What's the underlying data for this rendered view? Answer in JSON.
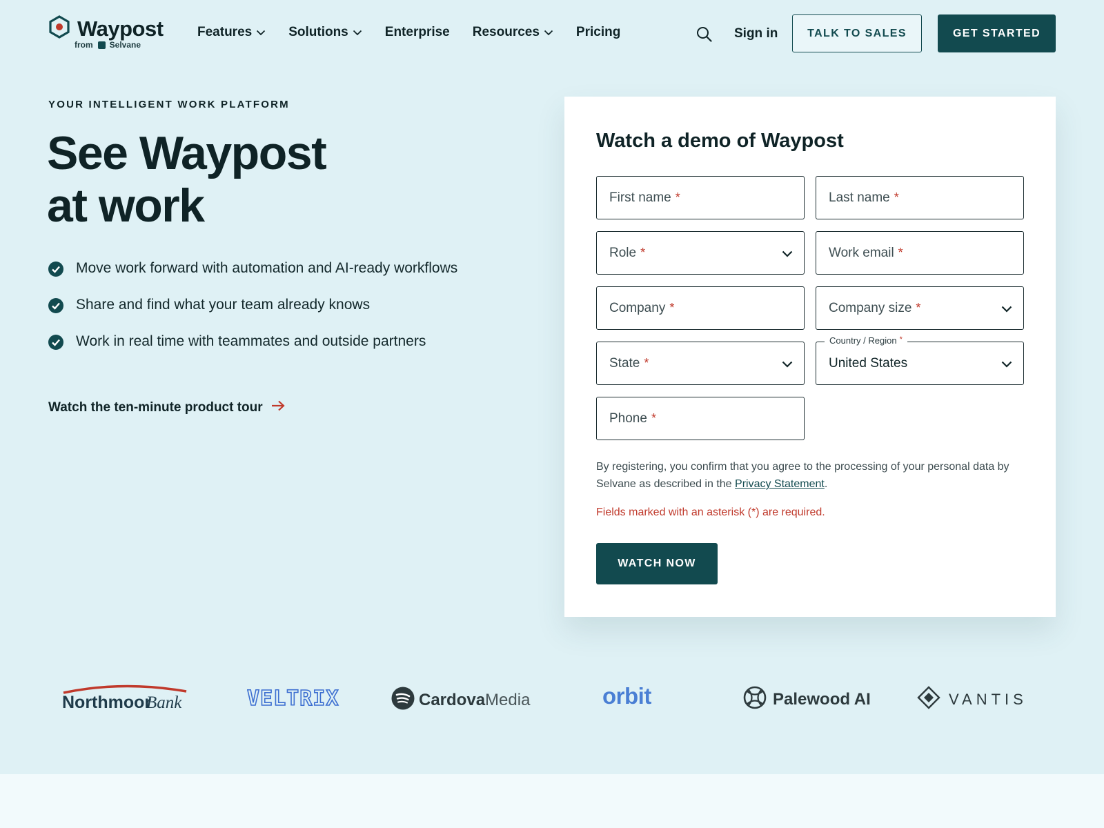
{
  "brand": {
    "name": "Waypost",
    "from_label": "from",
    "parent": "Selvane"
  },
  "nav": {
    "items": [
      {
        "label": "Features",
        "dropdown": true
      },
      {
        "label": "Solutions",
        "dropdown": true
      },
      {
        "label": "Enterprise",
        "dropdown": false
      },
      {
        "label": "Resources",
        "dropdown": true
      },
      {
        "label": "Pricing",
        "dropdown": false
      }
    ],
    "sign_in": "Sign in",
    "talk_to_sales": "TALK TO SALES",
    "get_started": "GET STARTED"
  },
  "hero": {
    "eyebrow": "YOUR INTELLIGENT WORK PLATFORM",
    "headline_line1": "See Waypost",
    "headline_line2": "at work",
    "bullets": [
      "Move work forward with automation and AI-ready workflows",
      "Share and find what your team already knows",
      "Work in real time with teammates and outside partners"
    ],
    "tour_link": "Watch the ten-minute product tour"
  },
  "form": {
    "title": "Watch a demo of Waypost",
    "required_mark": "*",
    "fields": {
      "first_name": "First name",
      "last_name": "Last name",
      "role": "Role",
      "work_email": "Work email",
      "company": "Company",
      "company_size": "Company size",
      "state": "State",
      "country_label": "Country / Region",
      "country_value": "United States",
      "phone": "Phone"
    },
    "consent_text": "By registering, you confirm that you agree to the processing of your personal data by Selvane as described in the ",
    "privacy_link": "Privacy Statement",
    "consent_end": ".",
    "required_note": "Fields marked with an asterisk (*) are required.",
    "submit": "WATCH NOW"
  },
  "customers": {
    "northmoor_a": "Northmoor",
    "northmoor_b": "Bank",
    "veltrix": "VELTRIX",
    "cardova_a": "Cardova",
    "cardova_b": "Media",
    "orbit": "orbit",
    "palewood": "Palewood AI",
    "vantis": "VANTIS"
  },
  "colors": {
    "background": "#dff1f5",
    "primary": "#124a4f",
    "accent_red": "#c0392b",
    "card": "#ffffff"
  }
}
